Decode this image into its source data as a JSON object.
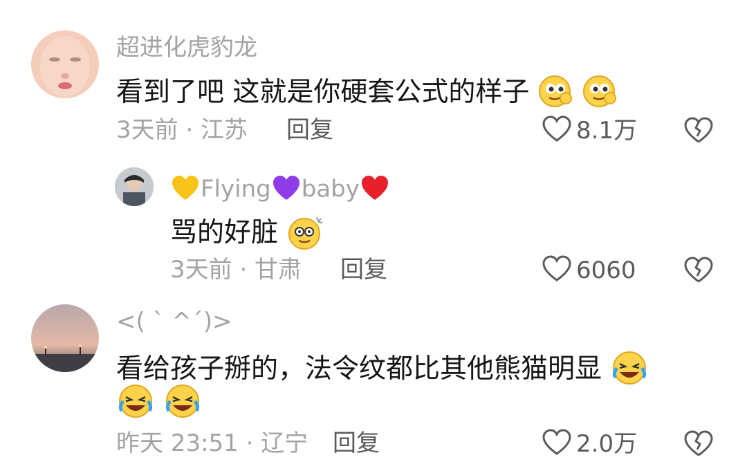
{
  "comments": [
    {
      "username": "超进化虎豹龙",
      "text": "看到了吧 这就是你硬套公式的样子",
      "time_location": "3天前 · 江苏",
      "reply_label": "回复",
      "likes": "8.1万",
      "emojis": [
        "yum-face-icon",
        "yum-face-icon"
      ]
    },
    {
      "username_parts": [
        "Flying",
        "baby"
      ],
      "text": "骂的好脏",
      "time_location": "3天前 · 甘肃",
      "reply_label": "回复",
      "likes": "6060",
      "emojis": [
        "dizzy-face-icon"
      ]
    },
    {
      "username": "<( ` ^´)>",
      "text": "看给孩子掰的，法令纹都比其他熊猫明显",
      "time_location": "昨天 23:51 · 辽宁",
      "reply_label": "回复",
      "likes": "2.0万",
      "emojis": [
        "rofl-face-icon",
        "rofl-face-icon",
        "rofl-face-icon"
      ]
    }
  ],
  "colors": {
    "meta_gray": "#a3a3a3",
    "text_dark": "#161616",
    "action_gray": "#5a5a5a",
    "heart_yellow": "#f7c21a",
    "heart_purple": "#8e3ce8",
    "heart_red": "#e8202a"
  }
}
